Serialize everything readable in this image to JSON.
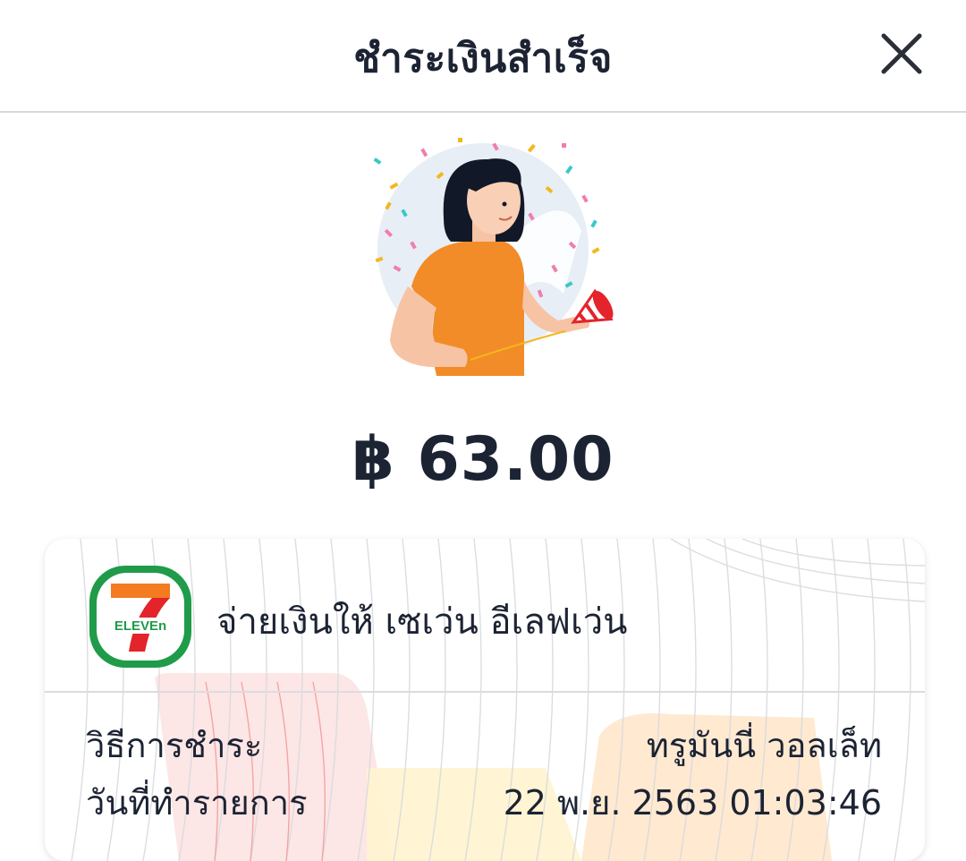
{
  "header": {
    "title": "ชำระเงินสำเร็จ",
    "close_icon": "close-icon"
  },
  "illustration": {
    "icon": "celebration-woman-illustration"
  },
  "payment": {
    "amount": "฿ 63.00"
  },
  "merchant": {
    "logo_icon": "7-eleven-logo",
    "logo_text": "ELEVEn",
    "logo_number": "7",
    "text": "จ่ายเงินให้ เซเว่น อีเลฟเว่น"
  },
  "details": [
    {
      "label": "วิธีการชำระ",
      "value": "ทรูมันนี่ วอลเล็ท"
    },
    {
      "label": "วันที่ทำรายการ",
      "value": "22 พ.ย. 2563 01:03:46"
    }
  ],
  "colors": {
    "text": "#1c2333",
    "shirt": "#f28c28",
    "logo_green": "#1f9b4a",
    "logo_orange": "#f47b20",
    "logo_red": "#e3242b"
  }
}
